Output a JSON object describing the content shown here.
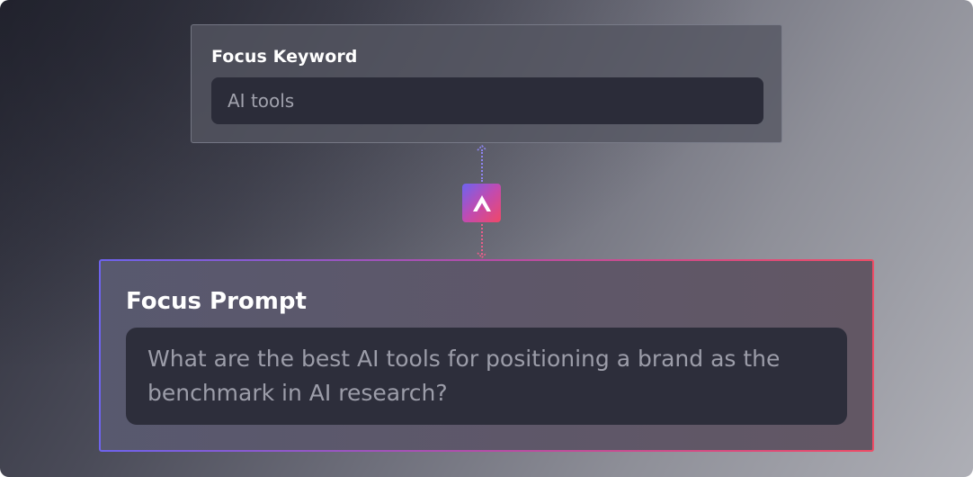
{
  "keyword": {
    "label": "Focus Keyword",
    "value": "AI tools"
  },
  "connector": {
    "logo_icon": "brand-logo-icon",
    "arrow_up_icon": "arrow-up-icon",
    "arrow_down_icon": "arrow-down-icon"
  },
  "prompt": {
    "label": "Focus Prompt",
    "value": "What are the best AI tools for positioning a brand as the benchmark in AI research?"
  },
  "colors": {
    "accent_start": "#6e63ee",
    "accent_mid": "#b64da8",
    "accent_end": "#f04c66"
  }
}
